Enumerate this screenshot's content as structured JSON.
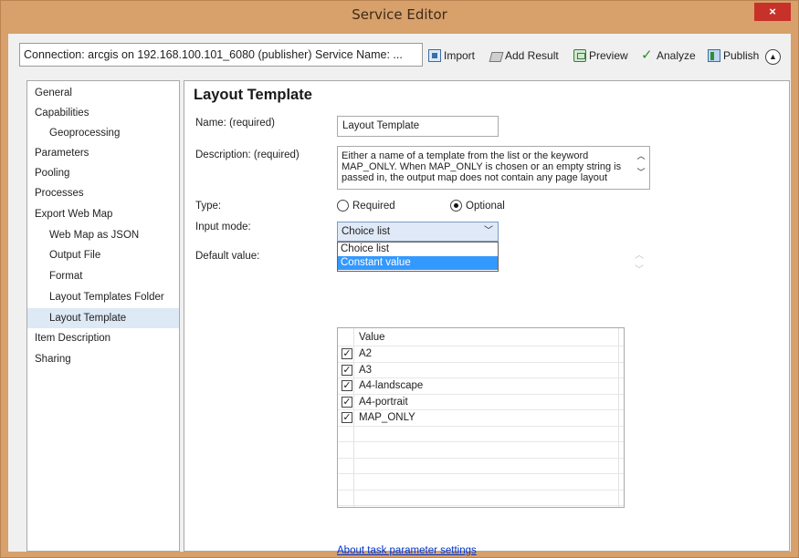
{
  "window": {
    "title": "Service Editor",
    "close_label": "×"
  },
  "toolbar": {
    "connection_text": "Connection: arcgis on 192.168.100.101_6080 (publisher)  Service Name: ...",
    "import_label": "Import",
    "add_result_label": "Add Result",
    "preview_label": "Preview",
    "analyze_label": "Analyze",
    "publish_label": "Publish"
  },
  "sidebar": {
    "items": [
      {
        "label": "General"
      },
      {
        "label": "Capabilities"
      },
      {
        "label": "Geoprocessing"
      },
      {
        "label": "Parameters"
      },
      {
        "label": "Pooling"
      },
      {
        "label": "Processes"
      },
      {
        "label": "Export Web Map"
      },
      {
        "label": "Web Map as JSON"
      },
      {
        "label": "Output File"
      },
      {
        "label": "Format"
      },
      {
        "label": "Layout Templates Folder"
      },
      {
        "label": "Layout Template"
      },
      {
        "label": "Item Description"
      },
      {
        "label": "Sharing"
      }
    ],
    "selected": "Layout Template"
  },
  "main": {
    "title": "Layout Template",
    "name_label": "Name:  (required)",
    "name_value": "Layout Template",
    "description_label": "Description:  (required)",
    "description_value": "Either a name of a template from the list or the keyword MAP_ONLY. When MAP_ONLY is chosen or an empty string is passed in, the output map does not contain any page layout",
    "type_label": "Type:",
    "type_required": "Required",
    "type_optional": "Optional",
    "type_selected": "Optional",
    "input_mode_label": "Input mode:",
    "input_mode_value": "Choice list",
    "input_mode_options": [
      "Choice list",
      "Constant value"
    ],
    "input_mode_highlighted": "Constant value",
    "default_value_label": "Default value:",
    "grid": {
      "header": "Value",
      "rows": [
        {
          "value": "A2",
          "checked": true
        },
        {
          "value": "A3",
          "checked": true
        },
        {
          "value": "A4-landscape",
          "checked": true
        },
        {
          "value": "A4-portrait",
          "checked": true
        },
        {
          "value": "MAP_ONLY",
          "checked": true
        }
      ]
    },
    "help_link": "About task parameter settings"
  }
}
